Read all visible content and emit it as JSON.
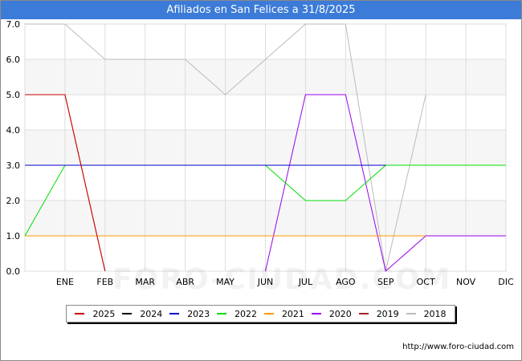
{
  "header": {
    "title": "Afiliados en San Felices a 31/8/2025"
  },
  "watermark": "FORO-CIUDAD.COM",
  "source": "http://www.foro-ciudad.com",
  "chart_data": {
    "type": "line",
    "title": "Afiliados en San Felices a 31/8/2025",
    "xlabel": "",
    "ylabel": "",
    "categories": [
      "",
      "ENE",
      "FEB",
      "MAR",
      "ABR",
      "MAY",
      "JUN",
      "JUL",
      "AGO",
      "SEP",
      "OCT",
      "NOV",
      "DIC"
    ],
    "y_ticks": [
      "0.0",
      "1.0",
      "2.0",
      "3.0",
      "4.0",
      "5.0",
      "6.0",
      "7.0"
    ],
    "ylim": [
      0,
      7
    ],
    "grid": true,
    "legend_position": "bottom",
    "series": [
      {
        "name": "2025",
        "color": "#cc0000",
        "values": [
          5,
          5,
          0
        ]
      },
      {
        "name": "2024",
        "color": "#000000",
        "values": []
      },
      {
        "name": "2023",
        "color": "#0000cc",
        "values": [
          3,
          3,
          3,
          3,
          3,
          3,
          3,
          3,
          3,
          3
        ]
      },
      {
        "name": "2022",
        "color": "#00dd00",
        "values": [
          1,
          3,
          3,
          3,
          3,
          3,
          3,
          2,
          2,
          3,
          3,
          3,
          3
        ]
      },
      {
        "name": "2021",
        "color": "#ff9900",
        "values": [
          1,
          1,
          1,
          1,
          1,
          1,
          1,
          1,
          1,
          1,
          1
        ]
      },
      {
        "name": "2020",
        "color": "#9900ee",
        "values": [
          null,
          null,
          null,
          null,
          null,
          null,
          0,
          5,
          5,
          0,
          1,
          1,
          1
        ]
      },
      {
        "name": "2019",
        "color": "#aa2222",
        "values": [
          5,
          5,
          0
        ]
      },
      {
        "name": "2018",
        "color": "#bbbbbb",
        "values": [
          7,
          7,
          6,
          6,
          6,
          5,
          6,
          7,
          7,
          0,
          5
        ]
      }
    ]
  }
}
